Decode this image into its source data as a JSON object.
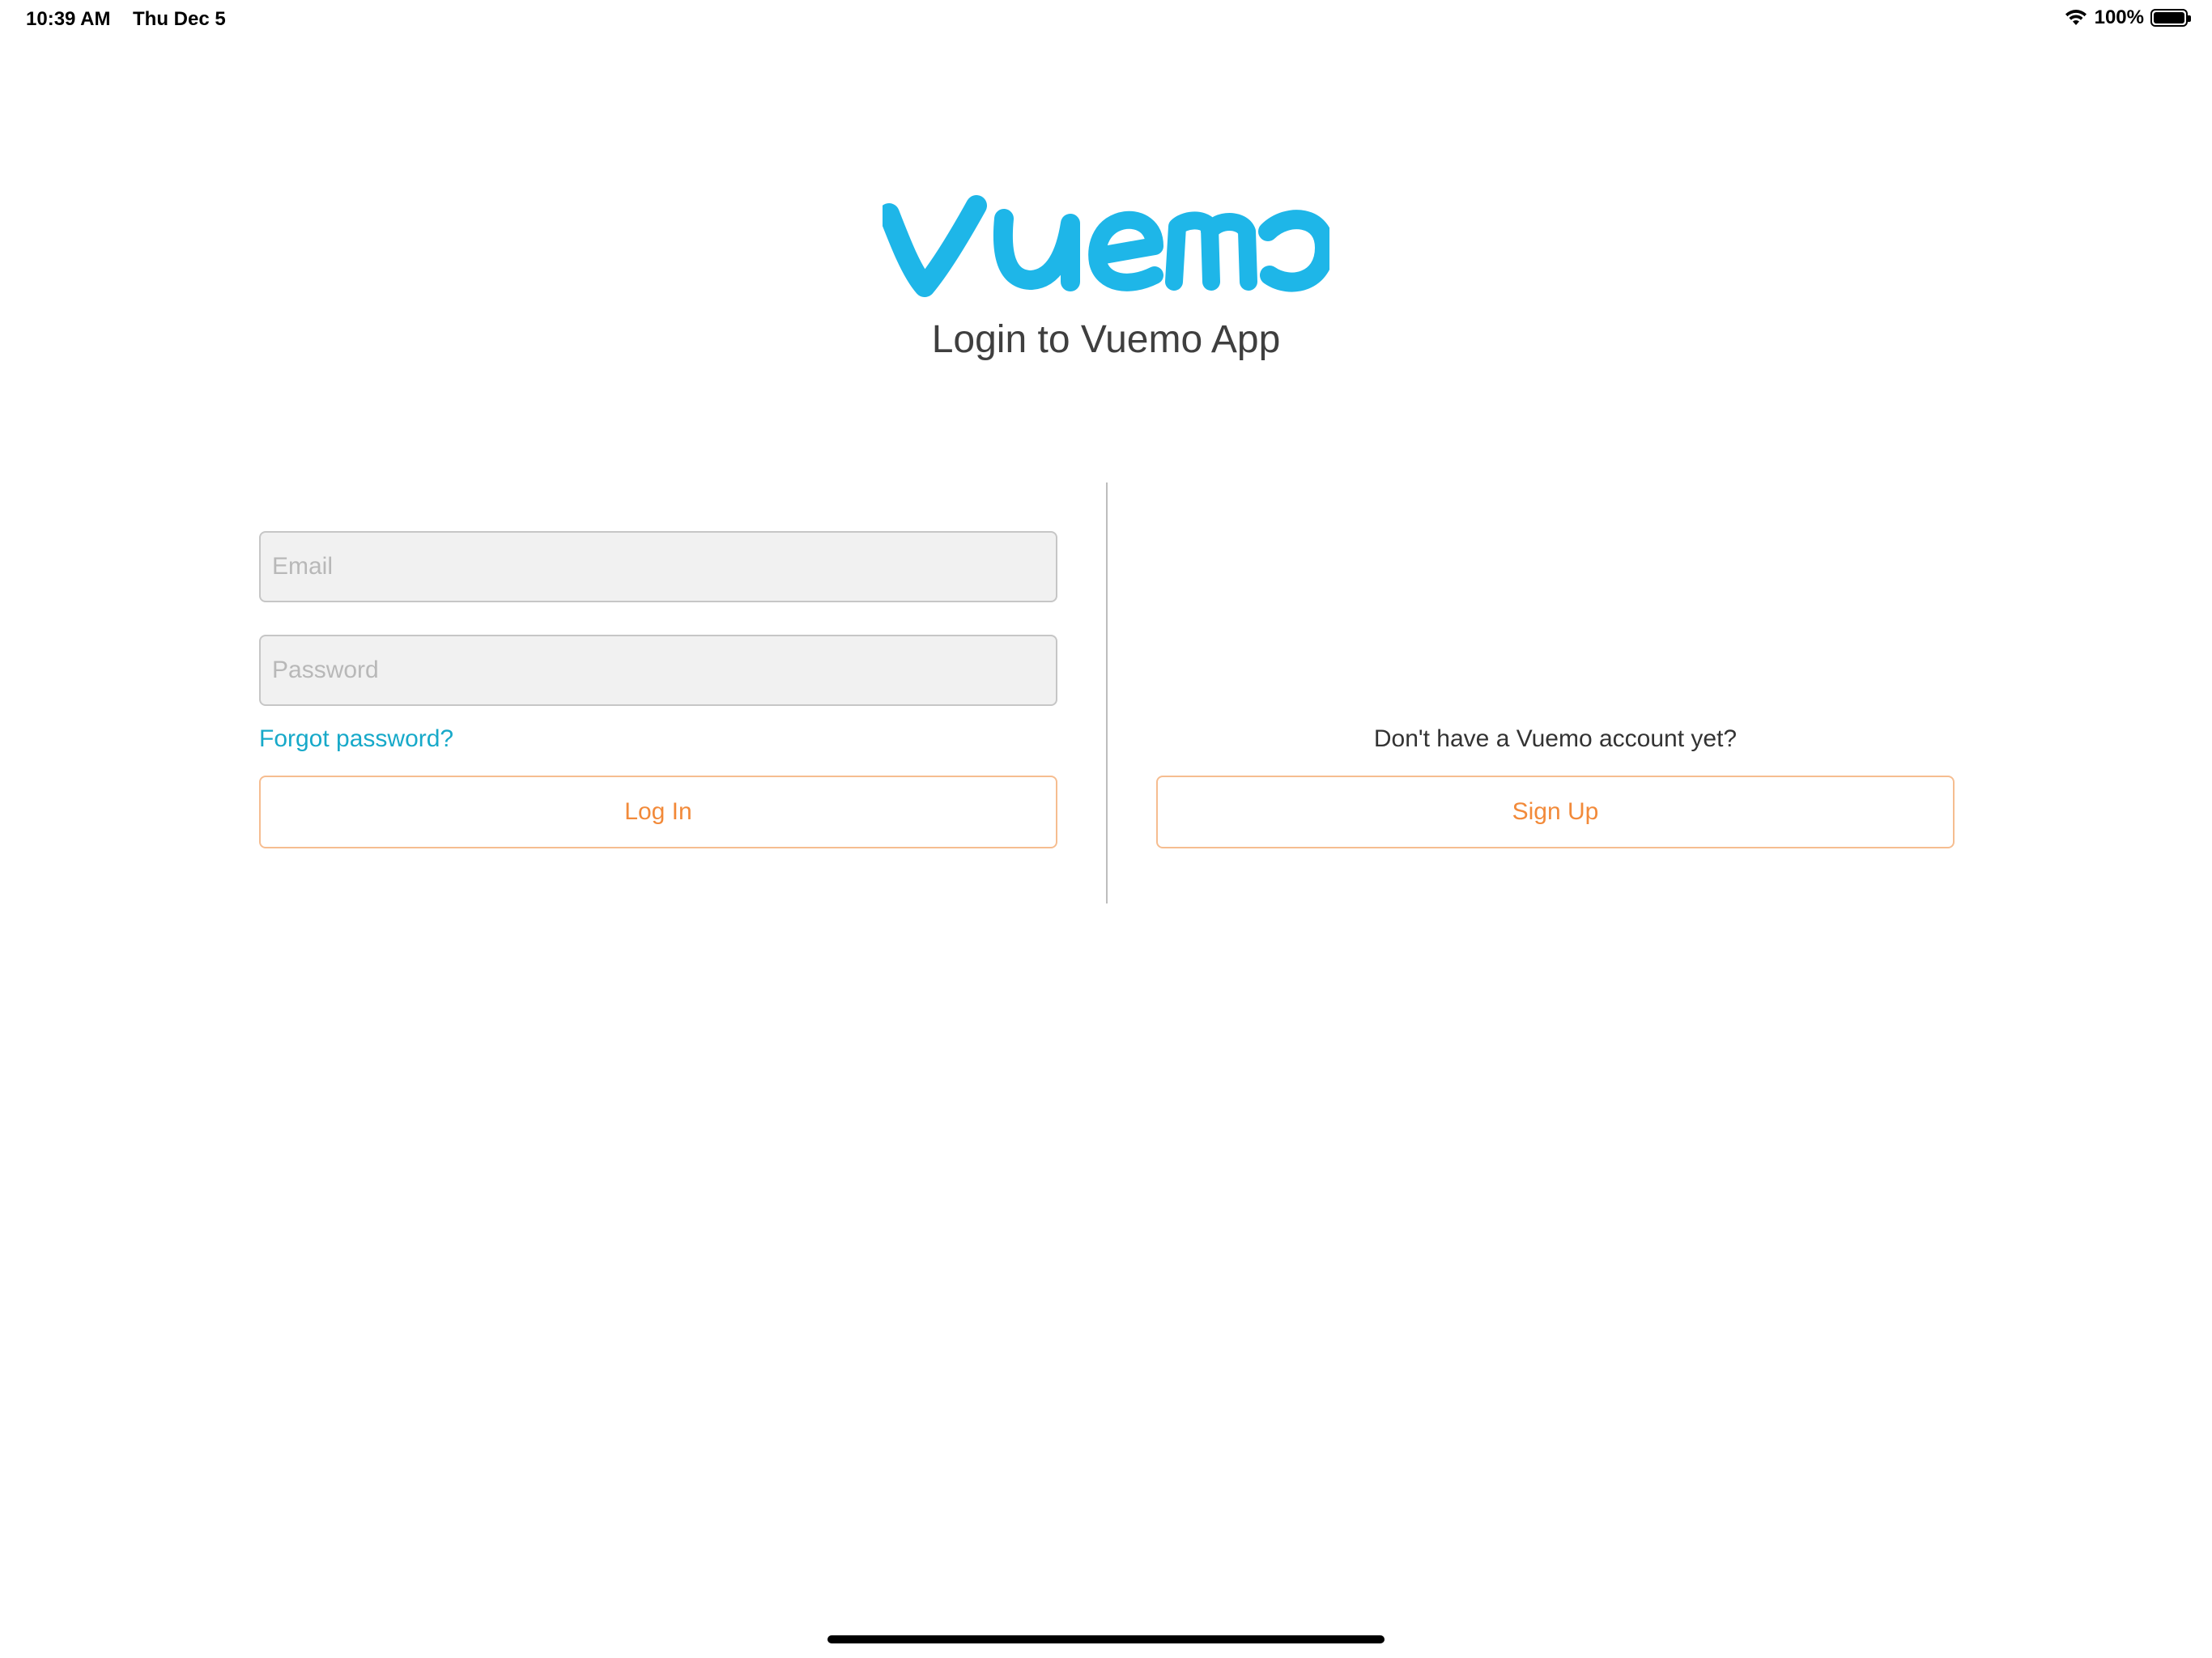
{
  "status_bar": {
    "time": "10:39 AM",
    "date": "Thu Dec 5",
    "battery_text": "100%",
    "battery_level": 1.0,
    "wifi_icon": "wifi-icon",
    "battery_icon": "battery-icon"
  },
  "logo": {
    "text": "vuemo",
    "color": "#1eb6e8"
  },
  "header": {
    "title": "Login to Vuemo App"
  },
  "login_form": {
    "email_placeholder": "Email",
    "email_value": "",
    "password_placeholder": "Password",
    "password_value": "",
    "forgot_label": "Forgot password?",
    "login_label": "Log In"
  },
  "signup": {
    "prompt": "Don't have a Vuemo account yet?",
    "button_label": "Sign Up"
  },
  "colors": {
    "accent_link": "#17a9c9",
    "button_text": "#f28a3a",
    "button_border": "#f6bd90",
    "field_bg": "#f1f1f1"
  }
}
